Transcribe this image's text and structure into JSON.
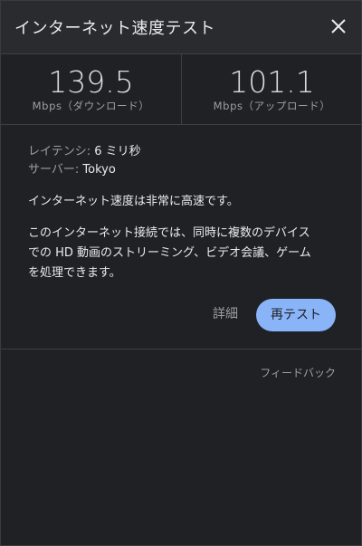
{
  "header": {
    "title": "インターネット速度テスト",
    "close_icon": "close-icon"
  },
  "speeds": {
    "download": {
      "value": "139.5",
      "unit": "Mbps（ダウンロード）"
    },
    "upload": {
      "value": "101.1",
      "unit": "Mbps（アップロード）"
    }
  },
  "info": {
    "latency_label": "レイテンシ:",
    "latency_value": "6 ミリ秒",
    "server_label": "サーバー:",
    "server_value": "Tokyo"
  },
  "summary": "インターネット速度は非常に高速です。",
  "description_lines": [
    "このインターネット接続では、同時に複数のデバイス",
    "での HD 動画のストリーミング、ビデオ会議、ゲーム",
    "を処理できます。"
  ],
  "actions": {
    "details_label": "詳細",
    "retest_label": "再テスト"
  },
  "footer": {
    "feedback_label": "フィードバック"
  },
  "colors": {
    "accent": "#8ab4f8",
    "background": "#202124",
    "header_background": "#2a2b2e"
  }
}
